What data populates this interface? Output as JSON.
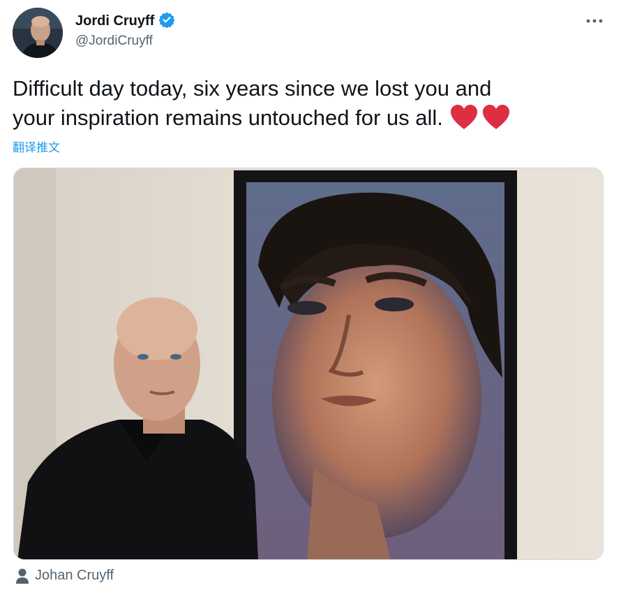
{
  "author": {
    "display_name": "Jordi Cruyff",
    "handle": "@JordiCruyff",
    "verified_icon": "verified-badge-icon"
  },
  "tweet": {
    "text": "Difficult day today, six years since we lost you and\nyour inspiration remains untouched for us all. ",
    "emoji": [
      "red-heart",
      "red-heart"
    ]
  },
  "translate_label": "翻译推文",
  "photo_tag": {
    "icon": "person-icon",
    "label": "Johan Cruyff"
  },
  "colors": {
    "accent": "#1d9bf0",
    "heart": "#e0245e",
    "secondary_text": "#536471"
  }
}
